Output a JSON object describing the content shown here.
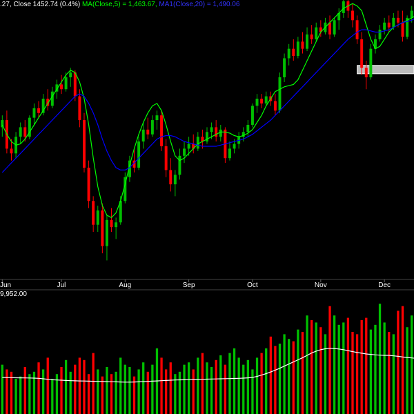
{
  "header": {
    "price_text": ".27, Close 1452.74 (0.4%)",
    "ma5_text": "MA(Close,5) = 1,463.67,",
    "ma20_text": "MA1(Close,20) = 1,490.06"
  },
  "volume_header": {
    "text": "9,952.00"
  },
  "colors": {
    "background": "#000000",
    "up": "#00c000",
    "down": "#ff0000",
    "ma5": "#00ff00",
    "ma20": "#0000ff",
    "volume_ma": "#ffffff",
    "text": "#ffffff"
  },
  "chart_data": [
    {
      "type": "candlestick",
      "title": "",
      "x_labels": [
        "Jun",
        "Jul",
        "Aug",
        "Sep",
        "Oct",
        "Nov",
        "Dec"
      ],
      "ylim": [
        1310,
        1545
      ],
      "series": [
        {
          "name": "MA(Close,5)",
          "values": [
            1440,
            1432,
            1426,
            1423,
            1424,
            1428,
            1434,
            1440,
            1446,
            1452,
            1458,
            1464,
            1470,
            1476,
            1482,
            1486,
            1484,
            1476,
            1462,
            1440,
            1412,
            1388,
            1372,
            1364,
            1362,
            1366,
            1376,
            1390,
            1406,
            1420,
            1432,
            1442,
            1450,
            1456,
            1458,
            1452,
            1440,
            1426,
            1414,
            1410,
            1412,
            1416,
            1420,
            1424,
            1426,
            1428,
            1430,
            1432,
            1434,
            1434,
            1433,
            1431,
            1430,
            1431,
            1433,
            1436,
            1442,
            1448,
            1456,
            1462,
            1468,
            1470,
            1472,
            1473,
            1474,
            1478,
            1486,
            1494,
            1502,
            1510,
            1518,
            1522,
            1526,
            1530,
            1534,
            1538,
            1540,
            1542,
            1540,
            1536,
            1524,
            1512,
            1504,
            1506,
            1512,
            1518,
            1522,
            1524,
            1526,
            1528,
            1530,
            1532
          ]
        },
        {
          "name": "MA1(Close,20)",
          "values": [
            1400,
            1404,
            1408,
            1412,
            1416,
            1420,
            1424,
            1428,
            1432,
            1436,
            1440,
            1444,
            1448,
            1452,
            1456,
            1460,
            1464,
            1466,
            1464,
            1458,
            1450,
            1440,
            1428,
            1418,
            1410,
            1404,
            1402,
            1402,
            1404,
            1408,
            1412,
            1416,
            1420,
            1424,
            1428,
            1430,
            1431,
            1431,
            1430,
            1428,
            1426,
            1425,
            1424,
            1423,
            1422,
            1422,
            1422,
            1422,
            1423,
            1424,
            1425,
            1426,
            1427,
            1428,
            1430,
            1432,
            1435,
            1438,
            1441,
            1444,
            1448,
            1452,
            1456,
            1460,
            1464,
            1468,
            1472,
            1476,
            1480,
            1484,
            1488,
            1492,
            1496,
            1500,
            1504,
            1508,
            1512,
            1515,
            1518,
            1520,
            1520,
            1519,
            1518,
            1518,
            1519,
            1520,
            1522,
            1524,
            1526,
            1527,
            1528,
            1530
          ]
        }
      ],
      "candles": [
        {
          "o": 1438,
          "h": 1448,
          "l": 1430,
          "c": 1444
        },
        {
          "o": 1444,
          "h": 1452,
          "l": 1416,
          "c": 1420
        },
        {
          "o": 1420,
          "h": 1428,
          "l": 1410,
          "c": 1416
        },
        {
          "o": 1416,
          "h": 1434,
          "l": 1412,
          "c": 1430
        },
        {
          "o": 1430,
          "h": 1442,
          "l": 1424,
          "c": 1438
        },
        {
          "o": 1438,
          "h": 1444,
          "l": 1426,
          "c": 1430
        },
        {
          "o": 1430,
          "h": 1448,
          "l": 1428,
          "c": 1446
        },
        {
          "o": 1446,
          "h": 1458,
          "l": 1440,
          "c": 1454
        },
        {
          "o": 1454,
          "h": 1460,
          "l": 1446,
          "c": 1450
        },
        {
          "o": 1450,
          "h": 1466,
          "l": 1448,
          "c": 1462
        },
        {
          "o": 1462,
          "h": 1470,
          "l": 1452,
          "c": 1456
        },
        {
          "o": 1456,
          "h": 1472,
          "l": 1454,
          "c": 1468
        },
        {
          "o": 1468,
          "h": 1478,
          "l": 1462,
          "c": 1474
        },
        {
          "o": 1474,
          "h": 1482,
          "l": 1466,
          "c": 1470
        },
        {
          "o": 1470,
          "h": 1484,
          "l": 1468,
          "c": 1480
        },
        {
          "o": 1480,
          "h": 1488,
          "l": 1472,
          "c": 1484
        },
        {
          "o": 1484,
          "h": 1486,
          "l": 1460,
          "c": 1464
        },
        {
          "o": 1464,
          "h": 1470,
          "l": 1438,
          "c": 1444
        },
        {
          "o": 1444,
          "h": 1450,
          "l": 1400,
          "c": 1404
        },
        {
          "o": 1404,
          "h": 1410,
          "l": 1370,
          "c": 1376
        },
        {
          "o": 1376,
          "h": 1380,
          "l": 1350,
          "c": 1356
        },
        {
          "o": 1356,
          "h": 1372,
          "l": 1350,
          "c": 1368
        },
        {
          "o": 1368,
          "h": 1374,
          "l": 1332,
          "c": 1338
        },
        {
          "o": 1338,
          "h": 1364,
          "l": 1326,
          "c": 1360
        },
        {
          "o": 1360,
          "h": 1370,
          "l": 1350,
          "c": 1354
        },
        {
          "o": 1354,
          "h": 1362,
          "l": 1344,
          "c": 1358
        },
        {
          "o": 1358,
          "h": 1380,
          "l": 1356,
          "c": 1376
        },
        {
          "o": 1376,
          "h": 1400,
          "l": 1374,
          "c": 1396
        },
        {
          "o": 1396,
          "h": 1414,
          "l": 1392,
          "c": 1410
        },
        {
          "o": 1410,
          "h": 1420,
          "l": 1400,
          "c": 1404
        },
        {
          "o": 1404,
          "h": 1430,
          "l": 1402,
          "c": 1426
        },
        {
          "o": 1426,
          "h": 1442,
          "l": 1420,
          "c": 1436
        },
        {
          "o": 1436,
          "h": 1446,
          "l": 1428,
          "c": 1432
        },
        {
          "o": 1432,
          "h": 1448,
          "l": 1430,
          "c": 1444
        },
        {
          "o": 1444,
          "h": 1452,
          "l": 1436,
          "c": 1448
        },
        {
          "o": 1448,
          "h": 1452,
          "l": 1418,
          "c": 1422
        },
        {
          "o": 1422,
          "h": 1428,
          "l": 1396,
          "c": 1402
        },
        {
          "o": 1402,
          "h": 1412,
          "l": 1384,
          "c": 1390
        },
        {
          "o": 1390,
          "h": 1402,
          "l": 1380,
          "c": 1398
        },
        {
          "o": 1398,
          "h": 1420,
          "l": 1394,
          "c": 1414
        },
        {
          "o": 1414,
          "h": 1426,
          "l": 1408,
          "c": 1420
        },
        {
          "o": 1420,
          "h": 1430,
          "l": 1414,
          "c": 1424
        },
        {
          "o": 1424,
          "h": 1432,
          "l": 1416,
          "c": 1420
        },
        {
          "o": 1420,
          "h": 1434,
          "l": 1418,
          "c": 1430
        },
        {
          "o": 1430,
          "h": 1436,
          "l": 1420,
          "c": 1426
        },
        {
          "o": 1426,
          "h": 1438,
          "l": 1424,
          "c": 1434
        },
        {
          "o": 1434,
          "h": 1442,
          "l": 1428,
          "c": 1438
        },
        {
          "o": 1438,
          "h": 1444,
          "l": 1426,
          "c": 1430
        },
        {
          "o": 1430,
          "h": 1440,
          "l": 1426,
          "c": 1436
        },
        {
          "o": 1436,
          "h": 1438,
          "l": 1408,
          "c": 1412
        },
        {
          "o": 1412,
          "h": 1426,
          "l": 1410,
          "c": 1420
        },
        {
          "o": 1420,
          "h": 1428,
          "l": 1416,
          "c": 1424
        },
        {
          "o": 1424,
          "h": 1434,
          "l": 1420,
          "c": 1430
        },
        {
          "o": 1430,
          "h": 1438,
          "l": 1426,
          "c": 1434
        },
        {
          "o": 1434,
          "h": 1444,
          "l": 1430,
          "c": 1440
        },
        {
          "o": 1440,
          "h": 1458,
          "l": 1438,
          "c": 1456
        },
        {
          "o": 1456,
          "h": 1466,
          "l": 1450,
          "c": 1462
        },
        {
          "o": 1462,
          "h": 1466,
          "l": 1454,
          "c": 1458
        },
        {
          "o": 1458,
          "h": 1468,
          "l": 1456,
          "c": 1464
        },
        {
          "o": 1464,
          "h": 1468,
          "l": 1456,
          "c": 1460
        },
        {
          "o": 1460,
          "h": 1466,
          "l": 1448,
          "c": 1452
        },
        {
          "o": 1452,
          "h": 1484,
          "l": 1450,
          "c": 1480
        },
        {
          "o": 1480,
          "h": 1500,
          "l": 1476,
          "c": 1496
        },
        {
          "o": 1496,
          "h": 1508,
          "l": 1490,
          "c": 1504
        },
        {
          "o": 1504,
          "h": 1512,
          "l": 1494,
          "c": 1498
        },
        {
          "o": 1498,
          "h": 1514,
          "l": 1496,
          "c": 1510
        },
        {
          "o": 1510,
          "h": 1518,
          "l": 1500,
          "c": 1504
        },
        {
          "o": 1504,
          "h": 1522,
          "l": 1502,
          "c": 1516
        },
        {
          "o": 1516,
          "h": 1524,
          "l": 1508,
          "c": 1512
        },
        {
          "o": 1512,
          "h": 1526,
          "l": 1510,
          "c": 1522
        },
        {
          "o": 1522,
          "h": 1528,
          "l": 1514,
          "c": 1518
        },
        {
          "o": 1518,
          "h": 1530,
          "l": 1516,
          "c": 1526
        },
        {
          "o": 1526,
          "h": 1532,
          "l": 1512,
          "c": 1516
        },
        {
          "o": 1516,
          "h": 1530,
          "l": 1514,
          "c": 1528
        },
        {
          "o": 1528,
          "h": 1538,
          "l": 1520,
          "c": 1534
        },
        {
          "o": 1534,
          "h": 1548,
          "l": 1530,
          "c": 1544
        },
        {
          "o": 1544,
          "h": 1546,
          "l": 1530,
          "c": 1536
        },
        {
          "o": 1536,
          "h": 1542,
          "l": 1522,
          "c": 1528
        },
        {
          "o": 1528,
          "h": 1532,
          "l": 1508,
          "c": 1512
        },
        {
          "o": 1512,
          "h": 1518,
          "l": 1482,
          "c": 1488
        },
        {
          "o": 1488,
          "h": 1494,
          "l": 1470,
          "c": 1480
        },
        {
          "o": 1480,
          "h": 1508,
          "l": 1478,
          "c": 1504
        },
        {
          "o": 1504,
          "h": 1516,
          "l": 1500,
          "c": 1512
        },
        {
          "o": 1512,
          "h": 1524,
          "l": 1510,
          "c": 1520
        },
        {
          "o": 1520,
          "h": 1530,
          "l": 1516,
          "c": 1526
        },
        {
          "o": 1526,
          "h": 1532,
          "l": 1518,
          "c": 1522
        },
        {
          "o": 1522,
          "h": 1534,
          "l": 1520,
          "c": 1530
        },
        {
          "o": 1530,
          "h": 1536,
          "l": 1522,
          "c": 1526
        },
        {
          "o": 1526,
          "h": 1536,
          "l": 1510,
          "c": 1514
        },
        {
          "o": 1514,
          "h": 1532,
          "l": 1512,
          "c": 1530
        },
        {
          "o": 1530,
          "h": 1540,
          "l": 1526,
          "c": 1536
        }
      ],
      "reference_band": {
        "from": 1483,
        "to": 1490
      }
    },
    {
      "type": "bar",
      "title": "",
      "ylim": [
        0,
        5000
      ],
      "values": [
        2100,
        1900,
        1800,
        1500,
        1600,
        2000,
        1700,
        1800,
        2200,
        1900,
        2400,
        1500,
        1700,
        2000,
        2300,
        1800,
        2100,
        2400,
        2300,
        1700,
        2600,
        1900,
        1600,
        2000,
        1700,
        1800,
        2400,
        2100,
        2000,
        1600,
        1900,
        2200,
        1800,
        2100,
        2800,
        2400,
        1900,
        2200,
        1700,
        1800,
        2100,
        2200,
        1900,
        2400,
        2600,
        2200,
        2000,
        2300,
        2500,
        2100,
        2600,
        2800,
        2400,
        2100,
        2300,
        1900,
        2400,
        2600,
        2800,
        3300,
        2900,
        3000,
        3400,
        3200,
        3100,
        3600,
        3500,
        4200,
        4000,
        3900,
        3700,
        3400,
        4600,
        4200,
        3800,
        3900,
        4100,
        3500,
        3400,
        4000,
        4100,
        3600,
        3800,
        4700,
        3900,
        3500,
        3400,
        4400,
        4600,
        3700,
        4200,
        3900
      ],
      "ma_values": [
        1560,
        1555,
        1550,
        1545,
        1540,
        1538,
        1536,
        1530,
        1520,
        1500,
        1480,
        1460,
        1450,
        1440,
        1430,
        1420,
        1415,
        1410,
        1405,
        1400,
        1395,
        1390,
        1385,
        1380,
        1375,
        1370,
        1365,
        1360,
        1360,
        1365,
        1370,
        1380,
        1390,
        1400,
        1410,
        1420,
        1430,
        1440,
        1450,
        1455,
        1460,
        1465,
        1470,
        1475,
        1480,
        1485,
        1490,
        1495,
        1500,
        1505,
        1510,
        1515,
        1520,
        1530,
        1540,
        1560,
        1600,
        1660,
        1720,
        1790,
        1870,
        1950,
        2040,
        2130,
        2220,
        2310,
        2400,
        2500,
        2600,
        2680,
        2740,
        2780,
        2800,
        2790,
        2770,
        2740,
        2700,
        2660,
        2620,
        2590,
        2560,
        2540,
        2520,
        2510,
        2500,
        2500,
        2480,
        2460,
        2430,
        2410,
        2390,
        2370
      ]
    }
  ]
}
